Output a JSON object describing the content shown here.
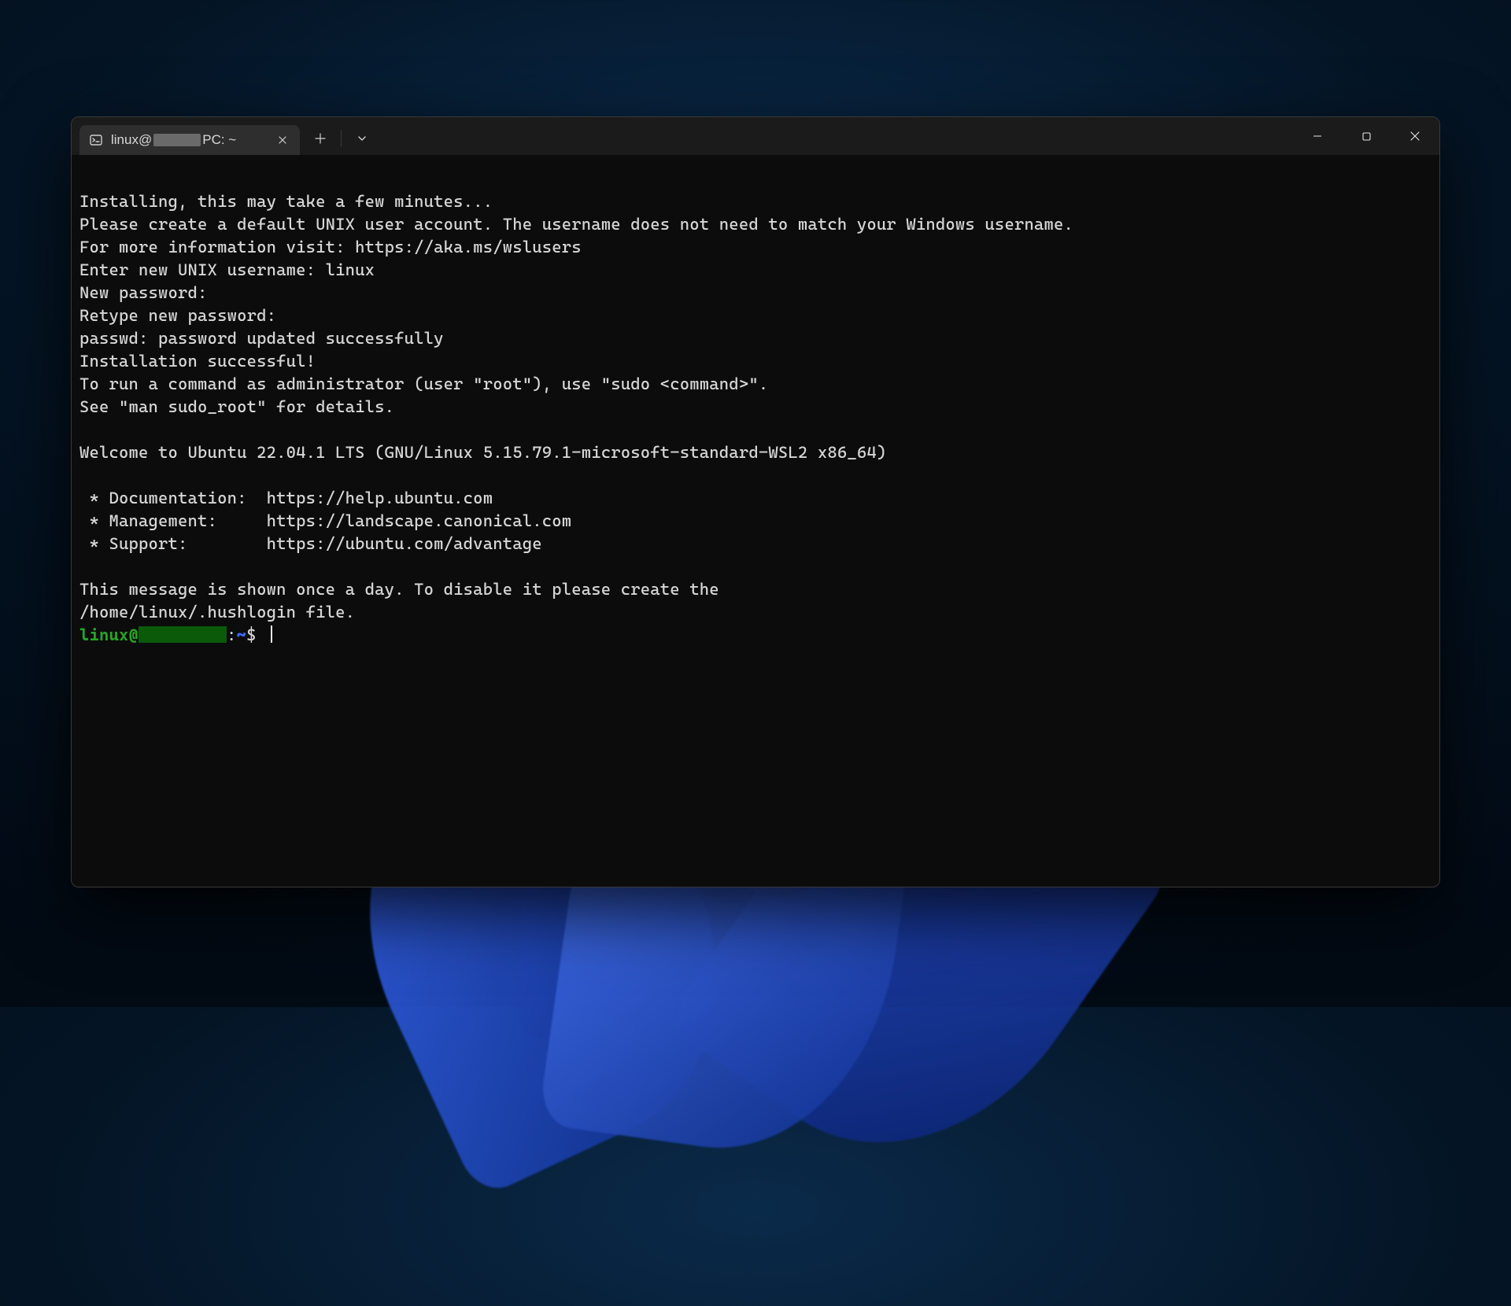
{
  "tab": {
    "title_prefix": "linux@",
    "title_suffix": "PC: ~"
  },
  "prompt": {
    "user_prefix": "linux@",
    "path": "~",
    "dollar": "$"
  },
  "output": {
    "l01": "Installing, this may take a few minutes...",
    "l02": "Please create a default UNIX user account. The username does not need to match your Windows username.",
    "l03": "For more information visit: https://aka.ms/wslusers",
    "l04": "Enter new UNIX username: linux",
    "l05": "New password:",
    "l06": "Retype new password:",
    "l07": "passwd: password updated successfully",
    "l08": "Installation successful!",
    "l09": "To run a command as administrator (user \"root\"), use \"sudo <command>\".",
    "l10": "See \"man sudo_root\" for details.",
    "l11": "",
    "l12": "Welcome to Ubuntu 22.04.1 LTS (GNU/Linux 5.15.79.1-microsoft-standard-WSL2 x86_64)",
    "l13": "",
    "l14": " * Documentation:  https://help.ubuntu.com",
    "l15": " * Management:     https://landscape.canonical.com",
    "l16": " * Support:        https://ubuntu.com/advantage",
    "l17": "",
    "l18": "This message is shown once a day. To disable it please create the",
    "l19": "/home/linux/.hushlogin file."
  }
}
